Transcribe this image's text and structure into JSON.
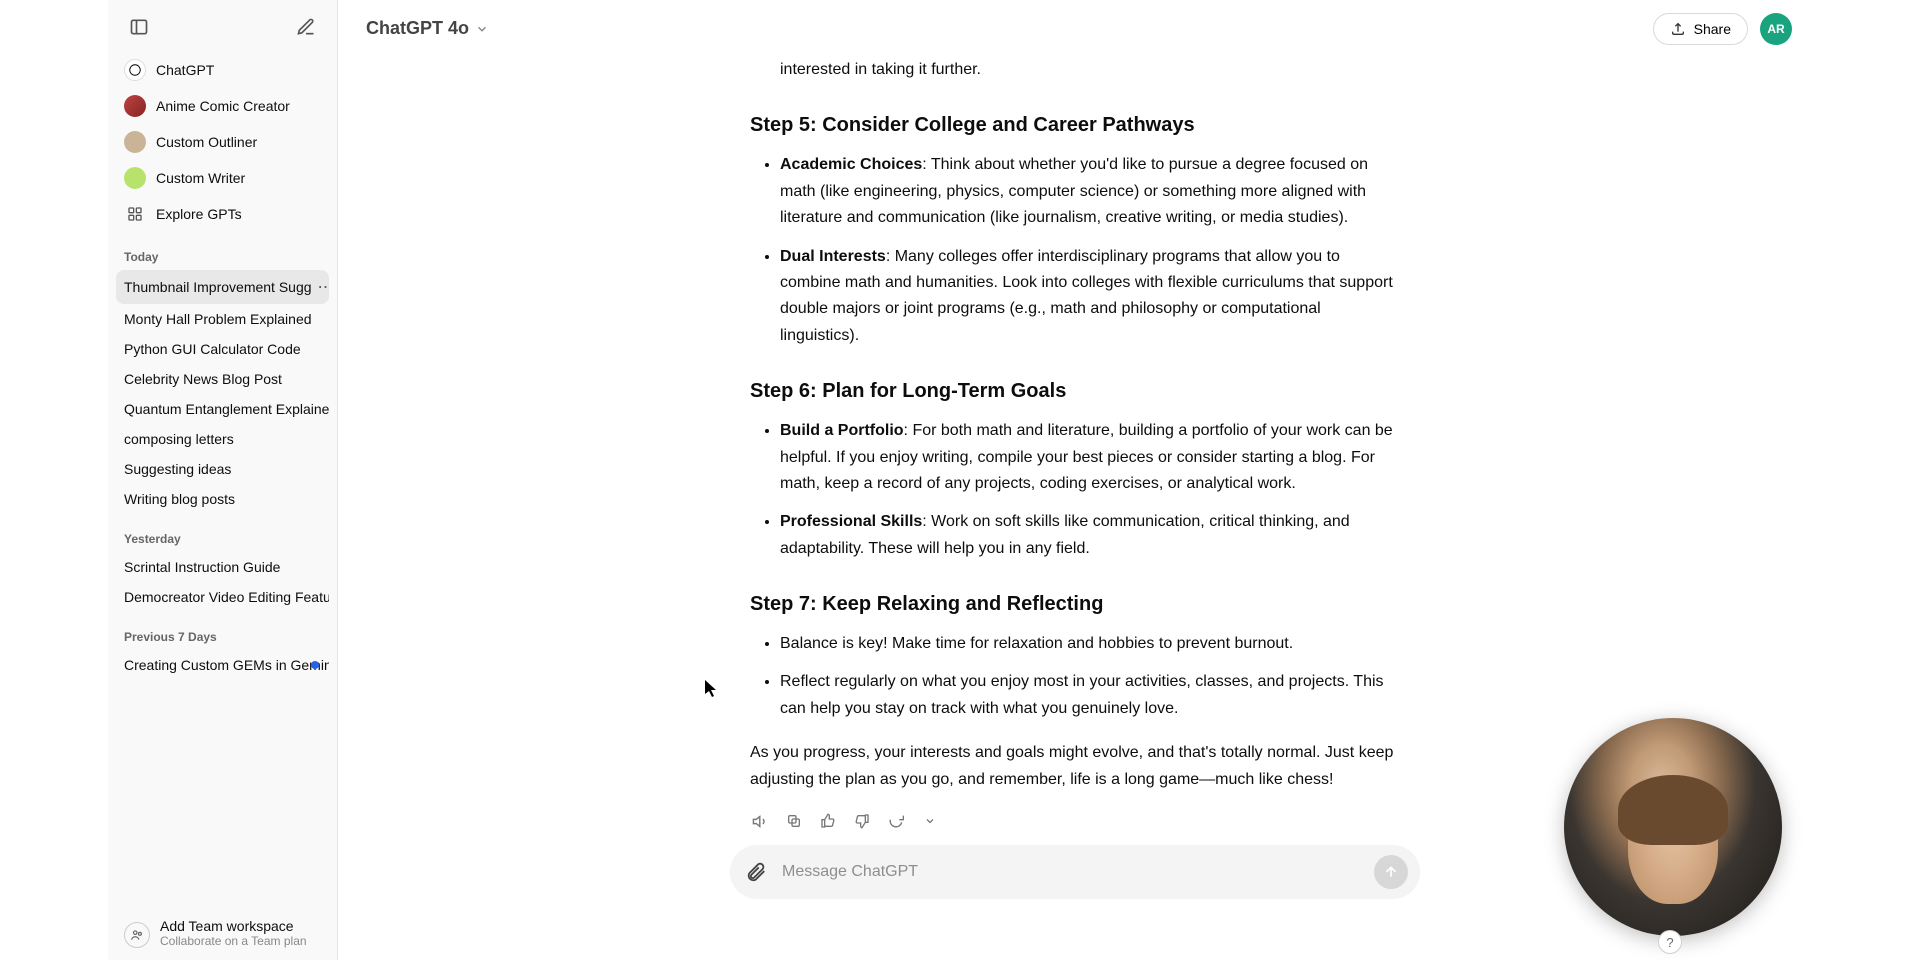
{
  "header": {
    "model": "ChatGPT 4o",
    "share": "Share",
    "profile_initials": "AR"
  },
  "sidebar": {
    "nav": [
      {
        "label": "ChatGPT"
      },
      {
        "label": "Anime Comic Creator"
      },
      {
        "label": "Custom Outliner"
      },
      {
        "label": "Custom Writer"
      },
      {
        "label": "Explore GPTs"
      }
    ],
    "sections": {
      "today": {
        "label": "Today",
        "items": [
          "Thumbnail Improvement Sugg",
          "Monty Hall Problem Explained",
          "Python GUI Calculator Code",
          "Celebrity News Blog Post",
          "Quantum Entanglement Explained",
          "composing letters",
          "Suggesting ideas",
          "Writing blog posts"
        ],
        "active_index": 0
      },
      "yesterday": {
        "label": "Yesterday",
        "items": [
          "Scrintal Instruction Guide",
          "Democreator Video Editing Featur"
        ],
        "dot_index": 1
      },
      "prev7": {
        "label": "Previous 7 Days",
        "items": [
          "Creating Custom GEMs in Gemin"
        ],
        "dot_index": 0
      }
    },
    "team": {
      "title": "Add Team workspace",
      "subtitle": "Collaborate on a Team plan"
    }
  },
  "message": {
    "partial_tail": "interested in taking it further.",
    "step5": {
      "heading": "Step 5: Consider College and Career Pathways",
      "b1_label": "Academic Choices",
      "b1_text": ": Think about whether you'd like to pursue a degree focused on math (like engineering, physics, computer science) or something more aligned with literature and communication (like journalism, creative writing, or media studies).",
      "b2_label": "Dual Interests",
      "b2_text": ": Many colleges offer interdisciplinary programs that allow you to combine math and humanities. Look into colleges with flexible curriculums that support double majors or joint programs (e.g., math and philosophy or computational linguistics)."
    },
    "step6": {
      "heading": "Step 6: Plan for Long-Term Goals",
      "b1_label": "Build a Portfolio",
      "b1_text": ": For both math and literature, building a portfolio of your work can be helpful. If you enjoy writing, compile your best pieces or consider starting a blog. For math, keep a record of any projects, coding exercises, or analytical work.",
      "b2_label": "Professional Skills",
      "b2_text": ": Work on soft skills like communication, critical thinking, and adaptability. These will help you in any field."
    },
    "step7": {
      "heading": "Step 7: Keep Relaxing and Reflecting",
      "b1_text": "Balance is key! Make time for relaxation and hobbies to prevent burnout.",
      "b2_text": "Reflect regularly on what you enjoy most in your activities, classes, and projects. This can help you stay on track with what you genuinely love."
    },
    "closing": "As you progress, your interests and goals might evolve, and that's totally normal. Just keep adjusting the plan as you go, and remember, life is a long game—much like chess!"
  },
  "composer": {
    "placeholder": "Message ChatGPT"
  },
  "help": "?"
}
